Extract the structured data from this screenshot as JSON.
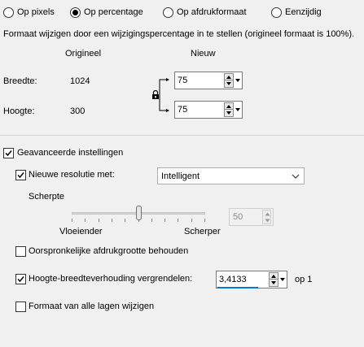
{
  "size_mode": {
    "options": [
      {
        "label": "Op pixels",
        "checked": false
      },
      {
        "label": "Op percentage",
        "checked": true
      },
      {
        "label": "Op afdrukformaat",
        "checked": false
      },
      {
        "label": "Eenzijdig",
        "checked": false
      }
    ]
  },
  "description": "Formaat wijzigen door een wijzigingspercentage in te stellen (origineel formaat  is 100%).",
  "columns": {
    "original": "Origineel",
    "new": "Nieuw"
  },
  "width": {
    "label": "Breedte:",
    "original": "1024",
    "new": "75"
  },
  "height": {
    "label": "Hoogte:",
    "original": "300",
    "new": "75"
  },
  "advanced": {
    "label": "Geavanceerde instellingen",
    "checked": true,
    "new_resolution": {
      "label": "Nieuwe resolutie met:",
      "checked": true,
      "method": "Intelligent"
    },
    "sharpness": {
      "label": "Scherpte",
      "min_label": "Vloeiender",
      "max_label": "Scherper",
      "value": "50",
      "slider_fraction": 0.5
    },
    "keep_print_size": {
      "label": "Oorspronkelijke afdrukgrootte behouden",
      "checked": false
    },
    "lock_ratio": {
      "label": "Hoogte-breedteverhouding vergrendelen:",
      "checked": true,
      "value": "3,4133",
      "suffix": "op 1"
    },
    "all_layers": {
      "label": "Formaat van alle lagen wijzigen",
      "checked": false
    }
  },
  "colors": {
    "accent": "#0078d7",
    "background": "#f0f0f0"
  }
}
